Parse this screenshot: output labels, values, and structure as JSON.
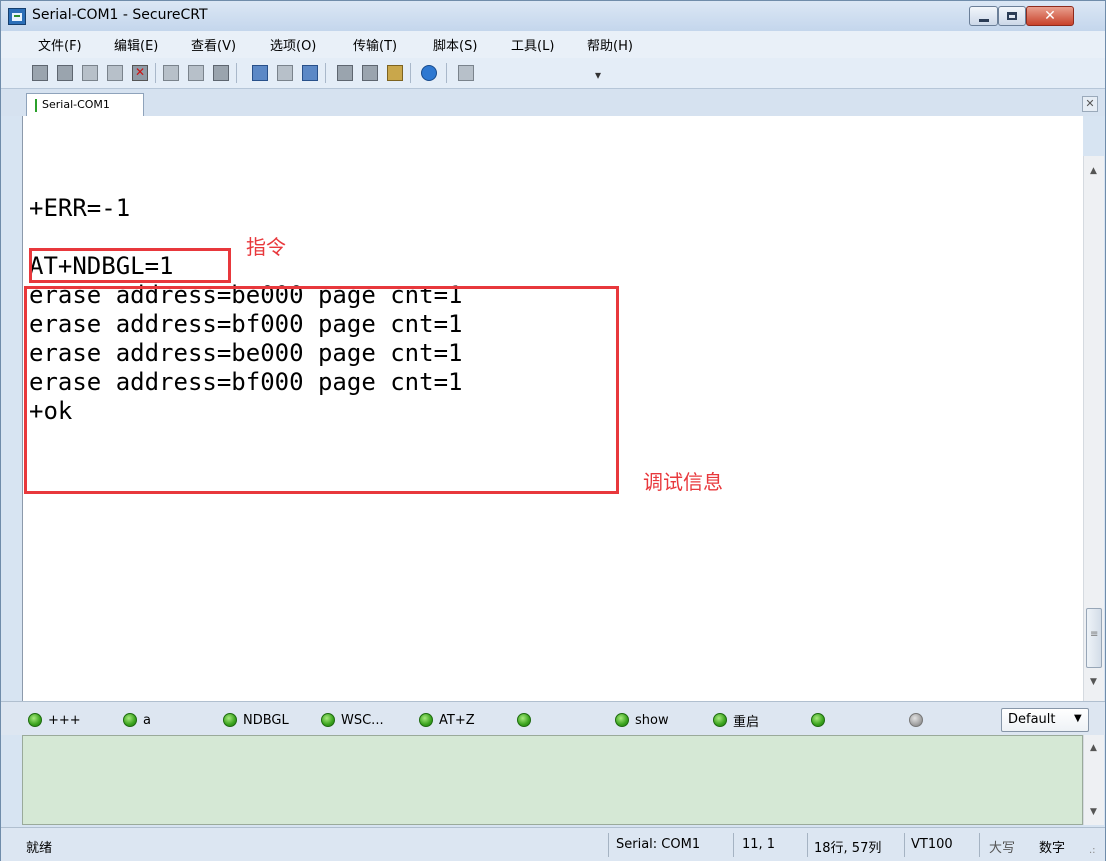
{
  "window": {
    "title": "Serial-COM1 - SecureCRT",
    "close_glyph": "✕"
  },
  "menu": [
    "文件(F)",
    "编辑(E)",
    "查看(V)",
    "选项(O)",
    "传输(T)",
    "脚本(S)",
    "工具(L)",
    "帮助(H)"
  ],
  "tab": {
    "label": "Serial-COM1",
    "close_glyph": "✕"
  },
  "terminal": {
    "lines": [
      "+ERR=-1",
      "",
      "AT+NDBGL=1",
      "erase address=be000 page cnt=1",
      "erase address=bf000 page cnt=1",
      "erase address=be000 page cnt=1",
      "erase address=bf000 page cnt=1",
      "+ok"
    ],
    "annotations": {
      "command": "指令",
      "debug_info": "调试信息"
    },
    "annotation_color": "#e8383c"
  },
  "button_bar": {
    "buttons": [
      "+++",
      "a",
      "NDBGL",
      "WSC...",
      "AT+Z",
      "",
      "show",
      "重启",
      "",
      ""
    ],
    "session": "Default"
  },
  "status": {
    "ready": "就绪",
    "connection": "Serial: COM1",
    "cursor": "11,  1",
    "size": "18行, 57列",
    "emulation": "VT100",
    "caps": "大写",
    "num": "数字"
  }
}
